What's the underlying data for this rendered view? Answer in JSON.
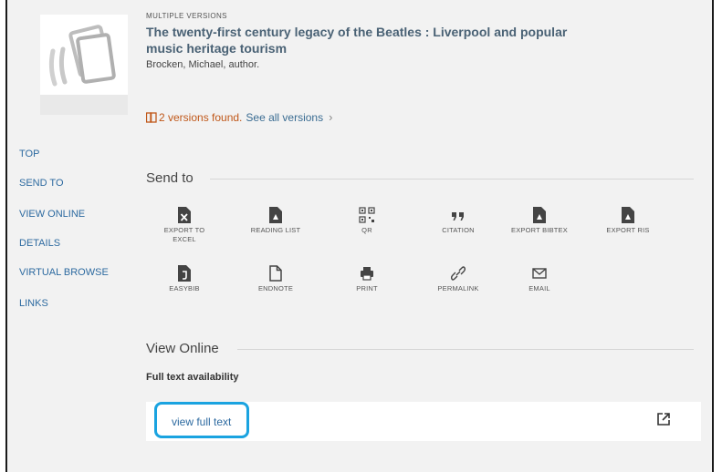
{
  "record": {
    "multiple_versions_label": "MULTIPLE VERSIONS",
    "title": "The twenty-first century legacy of the Beatles : Liverpool and popular music heritage tourism",
    "author": "Brocken, Michael, author.",
    "versions_found": "2 versions found.",
    "see_all_versions": "See all versions",
    "see_all_chevron": "›"
  },
  "nav": {
    "items": [
      {
        "label": "TOP"
      },
      {
        "label": "SEND TO"
      },
      {
        "label": "VIEW ONLINE"
      },
      {
        "label": "DETAILS"
      },
      {
        "label": "VIRTUAL BROWSE"
      },
      {
        "label": "LINKS"
      }
    ]
  },
  "send_to": {
    "heading": "Send to",
    "actions": [
      {
        "label": "EXPORT TO EXCEL",
        "label_line1": "EXPORT TO",
        "label_line2": "EXCEL",
        "icon": "excel-icon"
      },
      {
        "label": "READING LIST",
        "icon": "reading-list-icon"
      },
      {
        "label": "QR",
        "icon": "qr-icon"
      },
      {
        "label": "CITATION",
        "icon": "quote-icon"
      },
      {
        "label": "EXPORT BIBTEX",
        "icon": "bibtex-icon"
      },
      {
        "label": "EXPORT RIS",
        "icon": "ris-icon"
      },
      {
        "label": "EASYBIB",
        "icon": "easybib-icon"
      },
      {
        "label": "ENDNOTE",
        "icon": "endnote-icon"
      },
      {
        "label": "PRINT",
        "icon": "print-icon"
      },
      {
        "label": "PERMALINK",
        "icon": "link-icon"
      },
      {
        "label": "EMAIL",
        "icon": "email-icon"
      }
    ]
  },
  "view_online": {
    "heading": "View Online",
    "full_text_availability": "Full text availability",
    "view_full_text": "view full text"
  },
  "colors": {
    "accent_link": "#2d6aa0",
    "versions_orange": "#c0581a",
    "highlight_blue": "#1aa3e0"
  }
}
